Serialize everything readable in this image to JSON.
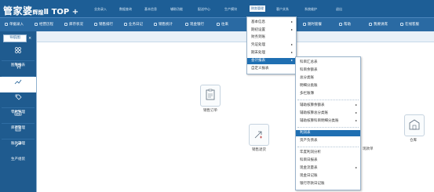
{
  "app": {
    "logo_main": "管家婆",
    "logo_sub": "辉煌",
    "logo_version": "Ⅱ TOP +"
  },
  "top_nav": [
    {
      "label": "业务录入"
    },
    {
      "label": "数据查询"
    },
    {
      "label": "基本信息"
    },
    {
      "label": "辅助功能"
    },
    {
      "label": "配送中心"
    },
    {
      "label": "生产模块"
    },
    {
      "label": "财务管理"
    },
    {
      "label": "客户关系"
    },
    {
      "label": "系统维护"
    },
    {
      "label": "退出"
    }
  ],
  "toolbar": [
    {
      "label": "单据录入"
    },
    {
      "label": "经营历程"
    },
    {
      "label": "库存状况"
    },
    {
      "label": "销售排行"
    },
    {
      "label": "业务日记"
    },
    {
      "label": "销售统计"
    },
    {
      "label": "现金银行"
    },
    {
      "label": "往来"
    },
    {
      "label": "调拨"
    },
    {
      "label": "随时套餐"
    },
    {
      "label": "帮助"
    },
    {
      "label": "我要讲席"
    },
    {
      "label": "在线客服"
    }
  ],
  "sidebar": {
    "tab_label": "导航图",
    "close_label": "×",
    "items": [
      {
        "label": "图形报表"
      },
      {
        "label": "采购管理"
      },
      {
        "label": "销售管理"
      },
      {
        "label": "零售管理"
      },
      {
        "label": "库存管理"
      },
      {
        "label": "账款管理"
      },
      {
        "label": "生产组装"
      }
    ]
  },
  "cards": [
    {
      "label": "销售订单"
    },
    {
      "label": "销售退货"
    },
    {
      "label": "现款单"
    },
    {
      "label": "仓库"
    }
  ],
  "finance_menu": [
    {
      "label": "基本信息",
      "has_submenu": true
    },
    {
      "label": "期初设置",
      "has_submenu": true
    },
    {
      "label": "财务到账",
      "has_submenu": false
    },
    {
      "label": "凭证处理",
      "has_submenu": true
    },
    {
      "label": "期末处理",
      "has_submenu": true
    },
    {
      "label": "会计报表",
      "has_submenu": true,
      "highlighted": true
    },
    {
      "label": "自定义报表",
      "has_submenu": false
    }
  ],
  "report_menu": [
    {
      "label": "科目汇总表",
      "has_submenu": false
    },
    {
      "label": "科目余额表",
      "has_submenu": false
    },
    {
      "label": "总分类账",
      "has_submenu": false
    },
    {
      "label": "明细分类账",
      "has_submenu": false
    },
    {
      "label": "多栏账簿",
      "has_submenu": false
    },
    {
      "label": "辅助核算余额表",
      "has_submenu": true
    },
    {
      "label": "辅助核算总分类账",
      "has_submenu": true
    },
    {
      "label": "辅助核算科目明细分类账",
      "has_submenu": true
    },
    {
      "label": "利润表",
      "has_submenu": false,
      "highlighted": true
    },
    {
      "label": "资产负债表",
      "has_submenu": false
    },
    {
      "label": "年度利润分析",
      "has_submenu": false
    },
    {
      "label": "科目日报表",
      "has_submenu": false
    },
    {
      "label": "现金流量表",
      "has_submenu": true
    },
    {
      "label": "现金日记账",
      "has_submenu": false
    },
    {
      "label": "银行存款日记账",
      "has_submenu": false
    }
  ],
  "colors": {
    "header_bg": "#1d5e96",
    "toolbar_bg": "#2a6aa3",
    "sidebar_bg": "#1f5b8f",
    "menu_highlight": "#1f6fb2"
  }
}
